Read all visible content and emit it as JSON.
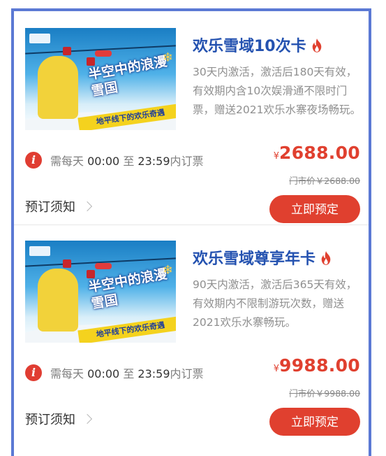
{
  "theme": {
    "accent": "#e0402f",
    "title_color": "#2452b0",
    "frame_color": "#5b79d4"
  },
  "cards": [
    {
      "image": {
        "headline": "半空中的浪漫雪国",
        "badge": "欢乐雪域",
        "banner": "地平线下的欢乐奇遇"
      },
      "title": "欢乐雪域10次卡",
      "title_icon": "fire-icon",
      "description": "30天内激活，激活后180天有效，有效期内含10次娱滑通不限时门票，赠送2021欢乐水寨夜场畅玩。",
      "notice": {
        "prefix": "需每天",
        "start": "00:00",
        "mid": "至",
        "end": "23:59",
        "suffix": "内订票"
      },
      "price": {
        "currency": "¥",
        "amount": "2688.00"
      },
      "original_price": "门市价￥2688.00",
      "notes_label": "预订须知",
      "book_label": "立即预定"
    },
    {
      "image": {
        "headline": "半空中的浪漫雪国",
        "badge": "欢乐雪域",
        "banner": "地平线下的欢乐奇遇"
      },
      "title": "欢乐雪域尊享年卡",
      "title_icon": "fire-icon",
      "description": "90天内激活，激活后365天有效，有效期内不限制游玩次数，赠送2021欢乐水寨畅玩。",
      "notice": {
        "prefix": "需每天",
        "start": "00:00",
        "mid": "至",
        "end": "23:59",
        "suffix": "内订票"
      },
      "price": {
        "currency": "¥",
        "amount": "9988.00"
      },
      "original_price": "门市价￥9988.00",
      "notes_label": "预订须知",
      "book_label": "立即预定"
    }
  ]
}
